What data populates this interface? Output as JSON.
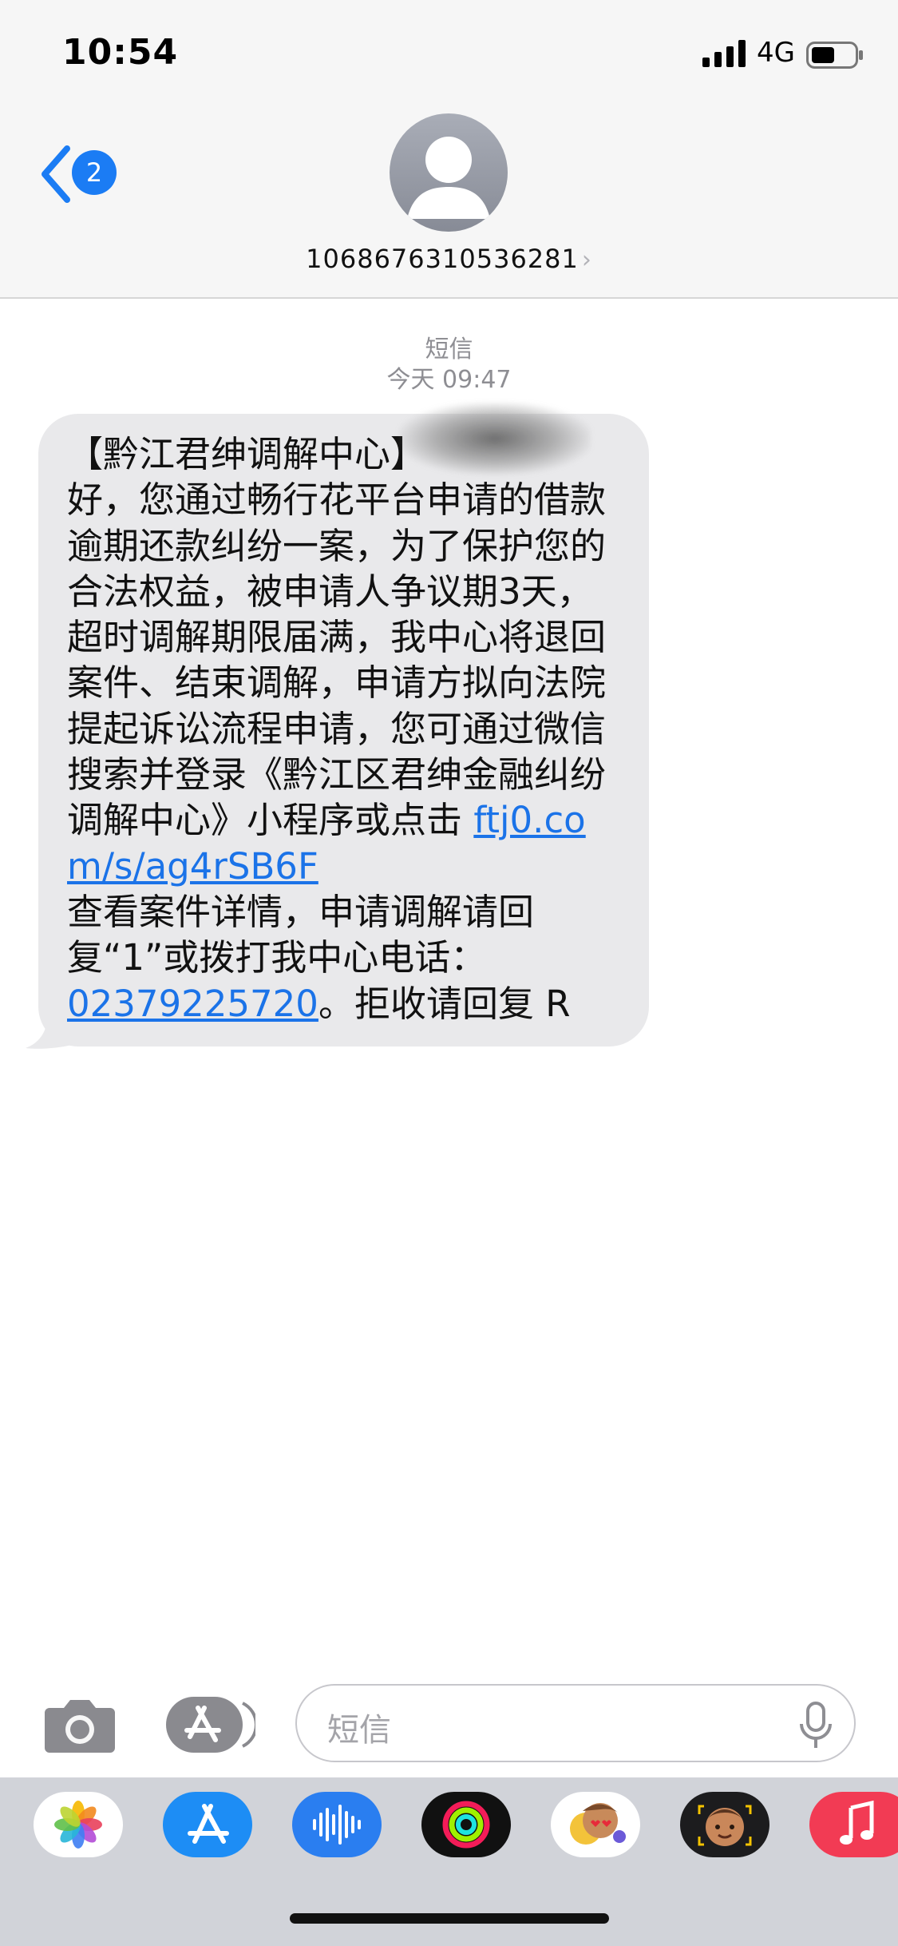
{
  "status_bar": {
    "time": "10:54",
    "network": "4G"
  },
  "header": {
    "badge_count": "2",
    "contact": "1068676310536281",
    "chevron": "›"
  },
  "conversation": {
    "type_label": "短信",
    "date_label": "今天",
    "time_label": "09:47",
    "message": {
      "text_before_link1": "【黔江君绅调解中心】\n好，您通过畅行花平台申请的借款逾期还款纠纷一案，为了保护您的合法权益，被申请人争议期3天，超时调解期限届满，我中心将退回案件、结束调解，申请方拟向法院提起诉讼流程申请，您可通过微信搜索并登录《黔江区君绅金融纠纷调解中心》小程序或点击 ",
      "link1": "ftj0.com/s/ag4rSB6F",
      "text_between": "\n查看案件详情，申请调解请回复“1”或拨打我中心电话：\n",
      "link2": "02379225720",
      "text_after": "。拒收请回复 R"
    }
  },
  "input_bar": {
    "placeholder": "短信"
  },
  "app_drawer": {
    "apps": [
      {
        "name": "photos-app-icon",
        "color": "#ffffff"
      },
      {
        "name": "app-store-app-icon",
        "color": "#1d8df5"
      },
      {
        "name": "audio-message-app-icon",
        "color": "#2a7ef0"
      },
      {
        "name": "fitness-app-icon",
        "color": "#111111"
      },
      {
        "name": "memoji-stickers-app-icon",
        "color": "#ffffff"
      },
      {
        "name": "animoji-app-icon",
        "color": "#1c1c1e"
      },
      {
        "name": "music-app-icon",
        "color": "#f23b54"
      }
    ]
  }
}
